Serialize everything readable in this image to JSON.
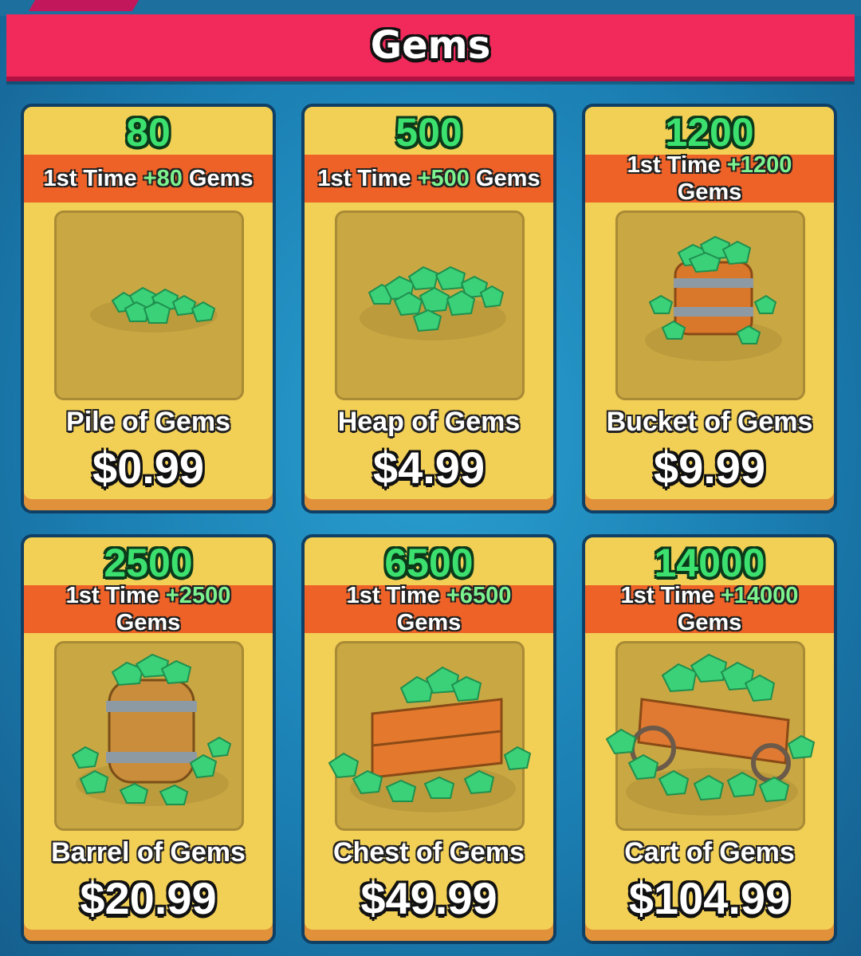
{
  "header": {
    "title": "Gems"
  },
  "offers": [
    {
      "amount": "80",
      "bonus_prefix": "1st Time",
      "bonus": "+80",
      "bonus_suffix": "Gems",
      "name": "Pile of Gems",
      "price": "$0.99",
      "icon": "gem-pile-icon"
    },
    {
      "amount": "500",
      "bonus_prefix": "1st Time",
      "bonus": "+500",
      "bonus_suffix": "Gems",
      "name": "Heap of Gems",
      "price": "$4.99",
      "icon": "gem-heap-icon"
    },
    {
      "amount": "1200",
      "bonus_prefix": "1st Time",
      "bonus": "+1200",
      "bonus_suffix": "Gems",
      "name": "Bucket of Gems",
      "price": "$9.99",
      "icon": "gem-bucket-icon"
    },
    {
      "amount": "2500",
      "bonus_prefix": "1st Time",
      "bonus": "+2500",
      "bonus_suffix": "Gems",
      "name": "Barrel of Gems",
      "price": "$20.99",
      "icon": "gem-barrel-icon"
    },
    {
      "amount": "6500",
      "bonus_prefix": "1st Time",
      "bonus": "+6500",
      "bonus_suffix": "Gems",
      "name": "Chest of Gems",
      "price": "$49.99",
      "icon": "gem-chest-icon"
    },
    {
      "amount": "14000",
      "bonus_prefix": "1st Time",
      "bonus": "+14000",
      "bonus_suffix": "Gems",
      "name": "Cart of Gems",
      "price": "$104.99",
      "icon": "gem-cart-icon"
    }
  ],
  "colors": {
    "header": "#f2295b",
    "card": "#f2cf55",
    "banner": "#ee6228",
    "gem": "#3ad179",
    "amount": "#3ce06f"
  }
}
